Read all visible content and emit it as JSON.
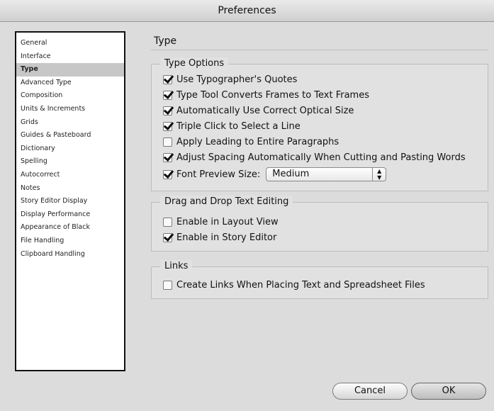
{
  "window": {
    "title": "Preferences"
  },
  "sidebar": {
    "items": [
      {
        "label": "General",
        "selected": false
      },
      {
        "label": "Interface",
        "selected": false
      },
      {
        "label": "Type",
        "selected": true
      },
      {
        "label": "Advanced Type",
        "selected": false
      },
      {
        "label": "Composition",
        "selected": false
      },
      {
        "label": "Units & Increments",
        "selected": false
      },
      {
        "label": "Grids",
        "selected": false
      },
      {
        "label": "Guides & Pasteboard",
        "selected": false
      },
      {
        "label": "Dictionary",
        "selected": false
      },
      {
        "label": "Spelling",
        "selected": false
      },
      {
        "label": "Autocorrect",
        "selected": false
      },
      {
        "label": "Notes",
        "selected": false
      },
      {
        "label": "Story Editor Display",
        "selected": false
      },
      {
        "label": "Display Performance",
        "selected": false
      },
      {
        "label": "Appearance of Black",
        "selected": false
      },
      {
        "label": "File Handling",
        "selected": false
      },
      {
        "label": "Clipboard Handling",
        "selected": false
      }
    ]
  },
  "pane": {
    "title": "Type"
  },
  "type_options": {
    "title": "Type Options",
    "use_quotes": {
      "label": "Use Typographer's Quotes",
      "checked": true
    },
    "convert_frames": {
      "label": "Type Tool Converts Frames to Text Frames",
      "checked": true
    },
    "optical_size": {
      "label": "Automatically Use Correct Optical Size",
      "checked": true
    },
    "triple_click": {
      "label": "Triple Click to Select a Line",
      "checked": true
    },
    "leading_paragraphs": {
      "label": "Apply Leading to Entire Paragraphs",
      "checked": false
    },
    "adjust_spacing": {
      "label": "Adjust Spacing Automatically When Cutting and Pasting Words",
      "checked": true
    },
    "font_preview": {
      "label": "Font Preview Size:",
      "checked": true,
      "value": "Medium"
    }
  },
  "drag_drop": {
    "title": "Drag and Drop Text Editing",
    "layout_view": {
      "label": "Enable in Layout View",
      "checked": false
    },
    "story_editor": {
      "label": "Enable in Story Editor",
      "checked": true
    }
  },
  "links": {
    "title": "Links",
    "create_links": {
      "label": "Create Links When Placing Text and Spreadsheet Files",
      "checked": false
    }
  },
  "buttons": {
    "cancel": "Cancel",
    "ok": "OK"
  }
}
